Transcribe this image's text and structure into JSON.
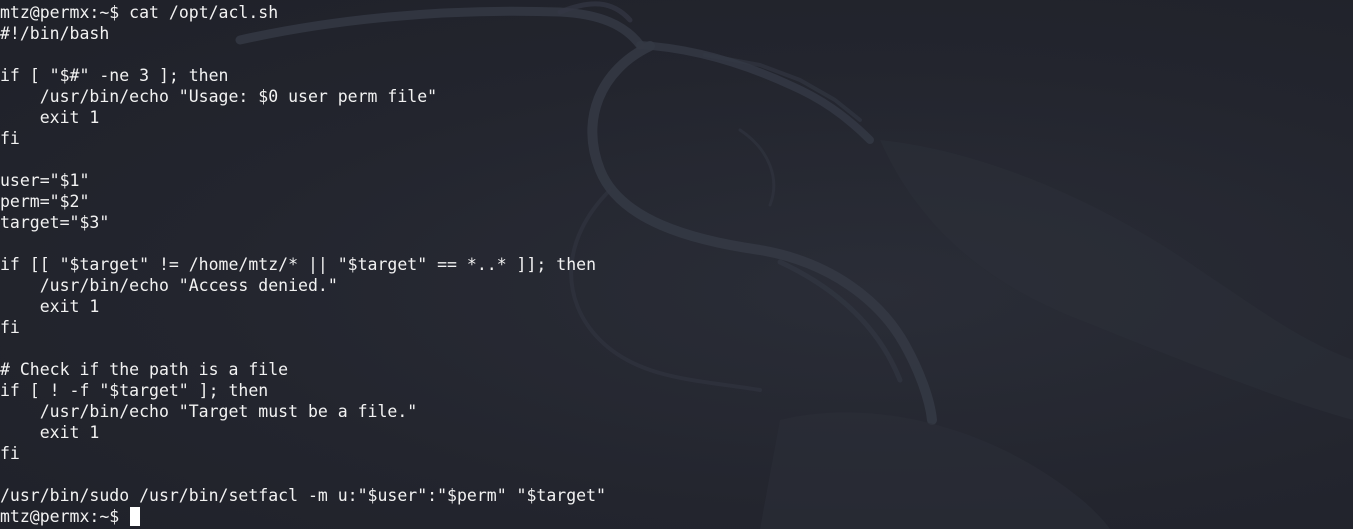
{
  "terminal": {
    "prompt": "mtz@permx:~$",
    "command": "cat /opt/acl.sh",
    "output_lines": [
      "#!/bin/bash",
      "",
      "if [ \"$#\" -ne 3 ]; then",
      "    /usr/bin/echo \"Usage: $0 user perm file\"",
      "    exit 1",
      "fi",
      "",
      "user=\"$1\"",
      "perm=\"$2\"",
      "target=\"$3\"",
      "",
      "if [[ \"$target\" != /home/mtz/* || \"$target\" == *..* ]]; then",
      "    /usr/bin/echo \"Access denied.\"",
      "    exit 1",
      "fi",
      "",
      "# Check if the path is a file",
      "if [ ! -f \"$target\" ]; then",
      "    /usr/bin/echo \"Target must be a file.\"",
      "    exit 1",
      "fi",
      "",
      "/usr/bin/sudo /usr/bin/setfacl -m u:\"$user\":\"$perm\" \"$target\""
    ],
    "final_prompt": "mtz@permx:~$",
    "colors": {
      "background": "#23252e",
      "text": "#f2f2f2",
      "cursor": "#ffffff"
    }
  },
  "wallpaper": {
    "icon": "kali-dragon-icon"
  }
}
